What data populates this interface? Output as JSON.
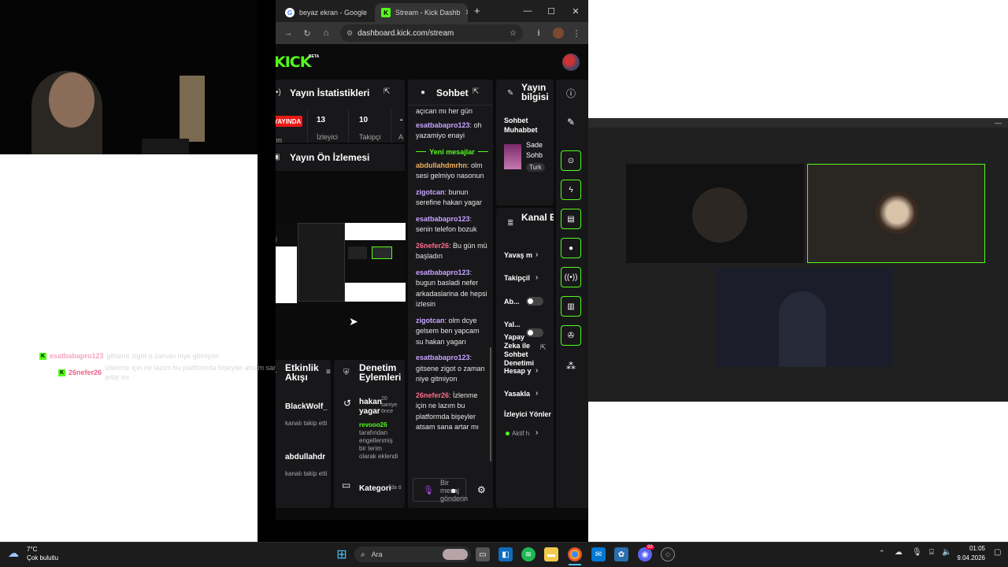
{
  "colors": {
    "kick_green": "#53fc18",
    "live_red": "#e91916",
    "panel_bg": "#18181b",
    "page_bg": "#0b0b0c"
  },
  "overlay_chat": [
    {
      "user": "esatbabapro123",
      "text": "gitsene zigot o zaman niye gitmiyon"
    },
    {
      "user": "26nefer26",
      "text": "İzlenme için ne lazım bu platformda bişeyler atsam sana artar mı"
    }
  ],
  "browser": {
    "tabs": [
      {
        "title": "beyaz ekran - Google",
        "icon": "google-icon"
      },
      {
        "title": "Stream - Kick Dashb",
        "icon": "kick-icon"
      }
    ],
    "new_tab": "+",
    "window_controls": {
      "minimize": "—",
      "maximize": "☐",
      "close": "✕"
    },
    "url": "dashboard.kick.com/stream"
  },
  "kick": {
    "logo": "KICK",
    "beta": "BETA",
    "stats": {
      "title": "Yayın İstatistikleri",
      "live_label": "YAYINDA",
      "partial_label": "yın",
      "items": [
        {
          "value": "13",
          "label": "İzleyici"
        },
        {
          "value": "10",
          "label": "Takipçi"
        },
        {
          "value": "-",
          "label": "A"
        }
      ]
    },
    "preview": {
      "title": "Yayın Ön İzlemesi"
    },
    "activity": {
      "title": "Etkinlik Akışı",
      "items": [
        {
          "name": "BlackWolf_",
          "action": "kanalı takip etti"
        },
        {
          "name": "abdullahdr",
          "action": "kanalı takip etti"
        }
      ]
    },
    "moderation": {
      "title": "Denetim Eylemleri",
      "items": [
        {
          "target": "hakan yagar",
          "time": "20 saniye önce",
          "moderator": "revooo26",
          "detail": "tarafından engellenmiş bir terim olarak eklendi"
        },
        {
          "target": "Kategori",
          "time": "da ö"
        }
      ]
    },
    "chat": {
      "title": "Sohbet",
      "new_messages_label": "Yeni mesajlar",
      "placeholder": "Bir mesaj gönderin",
      "messages_before": [
        {
          "user": "",
          "text": "açıcan mı her gün"
        },
        {
          "user": "esatbabapro123",
          "text": "oh yazamiyo enayi"
        }
      ],
      "messages_after": [
        {
          "user": "abdullahdmrhn",
          "text": "olm sesi gelmiyo nasonun",
          "color": "yellow"
        },
        {
          "user": "zigotcan",
          "text": "bunun serefine hakan yagar",
          "color": "purple"
        },
        {
          "user": "esatbabapro123",
          "text": "senin telefon bozuk",
          "color": "purple"
        },
        {
          "user": "26nefer26",
          "text": "Bu gün mü başladın",
          "color": "red"
        },
        {
          "user": "esatbabapro123",
          "text": "bugun basladi nefer arkadaslarina de hepsi izlesin",
          "color": "purple"
        },
        {
          "user": "zigotcan",
          "text": "olm dcye gelsem ben yapcam su hakan yagarı",
          "color": "purple"
        },
        {
          "user": "esatbabapro123",
          "text": "gitsene zigot o zaman niye gitmiyon",
          "color": "purple"
        },
        {
          "user": "26nefer26",
          "text": "İzlenme için ne lazım bu platformda bişeyler atsam sana artar mı",
          "color": "red"
        }
      ]
    },
    "stream_info": {
      "title": "Yayın bilgisi",
      "category_title": "Sohbet Muhabbet",
      "line1": "Sade",
      "line2": "Sohb",
      "tag": "Turk"
    },
    "channel_actions": {
      "title": "Kanal Eylemleri",
      "items": [
        "Yavaş m",
        "Takipçil",
        "Ab...",
        "Yal...",
        "Yapay Zeka ile Sohbet Denetimi",
        "Hesap y",
        "Yasakla",
        "İzleyici Yönler"
      ],
      "status": "Aktif h"
    }
  },
  "taskbar": {
    "weather_temp": "7°C",
    "weather_desc": "Çok bulutlu",
    "search": "Ara",
    "time": "01:05",
    "date": "9.04.2026",
    "notification_badge": "99"
  }
}
